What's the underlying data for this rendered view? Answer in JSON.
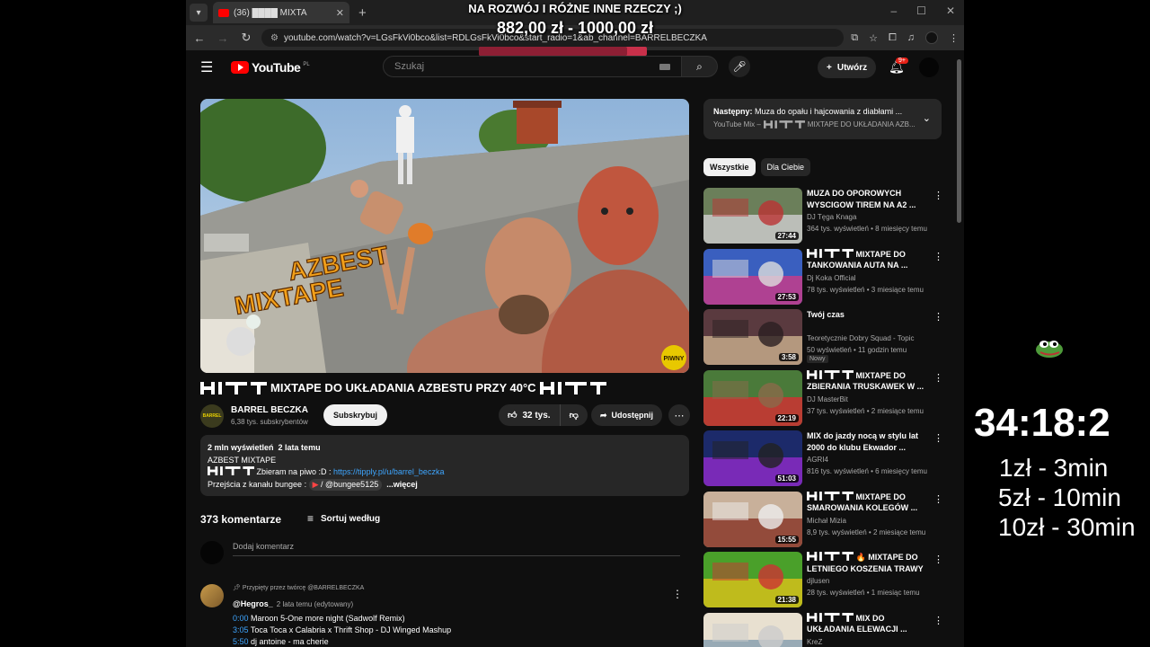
{
  "overlay": {
    "goal_text": "NA ROZWÓJ I RÓŻNE INNE RZECZY ;)",
    "goal_amounts": "882,00 zł - 1000,00 zł",
    "goal_progress": 0.882,
    "timer": "34:18:2",
    "prices": [
      "1zł - 3min",
      "5zł - 10min",
      "10zł - 30min"
    ]
  },
  "browser": {
    "tab_title": "(36) ████ MIXTA",
    "url": "youtube.com/watch?v=LGsFkVi0bco&list=RDLGsFkVi0bco&start_radio=1&ab_channel=BARRELBECZKA",
    "window_controls": [
      "–",
      "☐",
      "✕"
    ]
  },
  "yt": {
    "logo": "YouTube",
    "logo_country": "PL",
    "search_placeholder": "Szukaj",
    "create_label": "Utwórz",
    "notif_badge": "9+"
  },
  "video": {
    "title": "MIXTAPE DO UKŁADANIA AZBESTU PRZY 40°C",
    "thumb_text": [
      "AZBEST",
      "MIXTAPE"
    ],
    "thumb_badge": "PIWNY",
    "channel_name": "BARREL BECZKA",
    "channel_subs": "6,38 tys. subskrybentów",
    "channel_avatar_text": "BARREL",
    "subscribe_label": "Subskrybuj",
    "likes": "32 tys.",
    "share_label": "Udostępnij",
    "views": "2 mln wyświetleń",
    "age": "2 lata temu",
    "desc_line1": "AZBEST MIXTAPE",
    "desc_line2_text": "Zbieram na piwo :D : ",
    "desc_link": "https://tipply.pl/u/barrel_beczka",
    "desc_line3_text": "Przejścia z kanału bungee : ",
    "desc_bungee": "/ @bungee5125",
    "desc_more": "...więcej"
  },
  "comments": {
    "count": "373 komentarze",
    "sort_label": "Sortuj według",
    "add_placeholder": "Dodaj komentarz",
    "pinned": {
      "pinned_by": "Przypięty przez twórcę @BARRELBECZKA",
      "author": "@Hegros_",
      "meta": "2 lata temu (edytowany)",
      "lines": [
        {
          "ts": "0:00",
          "text": "Maroon 5-One more night (Sadwolf Remix)"
        },
        {
          "ts": "3:05",
          "text": "Toca Toca x Calabria x Thrift Shop - DJ Winged Mashup"
        },
        {
          "ts": "5:50",
          "text": "dj antoine - ma cherie"
        }
      ]
    }
  },
  "sidebar": {
    "next_label": "Następny:",
    "next_title": "Muza do opału i hajcowania z diabłami ...",
    "next_sub_prefix": "YouTube Mix –",
    "next_sub_suffix": "MIXTAPE DO UKŁADANIA AZB...",
    "chips": [
      "Wszystkie",
      "Dla Ciebie"
    ],
    "items": [
      {
        "title": "MUZA DO OPOROWYCH WYSCIGOW TIREM NA A2 ...",
        "channel": "DJ Tęga Knaga",
        "stats": "364 tys. wyświetleń • 8 miesięcy temu",
        "duration": "27:44",
        "hit": false,
        "fire": false,
        "badge": "",
        "thumb_colors": [
          "#6b7f5a",
          "#c9c9c9",
          "#b33"
        ]
      },
      {
        "title": "MIXTAPE DO TANKOWANIA AUTA NA ...",
        "channel": "Dj Koka Official",
        "stats": "78 tys. wyświetleń • 3 miesiące temu",
        "duration": "27:53",
        "hit": true,
        "fire": false,
        "badge": "",
        "thumb_colors": [
          "#3a5fbf",
          "#c43c8a",
          "#ddd"
        ]
      },
      {
        "title": "Twój czas",
        "channel": "Teoretycznie Dobry Squad - Topic",
        "stats": "50 wyświetleń • 11 godzin temu",
        "duration": "3:58",
        "hit": false,
        "fire": false,
        "badge": "Nowy",
        "thumb_colors": [
          "#5a3a3f",
          "#c4a98a",
          "#2a1f22"
        ]
      },
      {
        "title": "MIXTAPE DO ZBIERANIA TRUSKAWEK W ...",
        "channel": "DJ MasterBit",
        "stats": "37 tys. wyświetleń • 2 miesiące temu",
        "duration": "22:19",
        "hit": true,
        "fire": false,
        "badge": "",
        "thumb_colors": [
          "#4a7a3a",
          "#c33",
          "#8a6a4a"
        ]
      },
      {
        "title": "MIX do jazdy nocą w stylu lat 2000 do klubu Ekwador ...",
        "channel": "AGRI4",
        "stats": "816 tys. wyświetleń • 6 miesięcy temu",
        "duration": "51:03",
        "hit": false,
        "fire": false,
        "badge": "",
        "thumb_colors": [
          "#1c2a6a",
          "#8a2ac4",
          "#222"
        ]
      },
      {
        "title": "MIXTAPE DO SMAROWANIA KOLEGÓW ...",
        "channel": "Michał Mizia",
        "stats": "8,9 tys. wyświetleń • 2 miesiące temu",
        "duration": "15:55",
        "hit": true,
        "fire": false,
        "badge": "",
        "thumb_colors": [
          "#c8b09a",
          "#8a3a2a",
          "#eee"
        ]
      },
      {
        "title": "MIXTAPE DO LETNIEGO KOSZENIA TRAWY ...",
        "channel": "djlusen",
        "stats": "28 tys. wyświetleń • 1 miesiąc temu",
        "duration": "21:38",
        "hit": true,
        "fire": true,
        "badge": "",
        "thumb_colors": [
          "#4aa02a",
          "#d4c01a",
          "#c33"
        ]
      },
      {
        "title": "MIX DO UKŁADANIA ELEWACJI ...",
        "channel": "KreZ",
        "stats": "",
        "duration": "",
        "hit": true,
        "fire": false,
        "badge": "",
        "thumb_colors": [
          "#e8e0d0",
          "#8aa0b0",
          "#ccc"
        ]
      }
    ]
  }
}
